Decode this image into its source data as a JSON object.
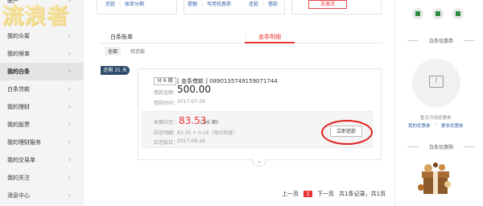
{
  "watermark": "流浪者",
  "sidebar": {
    "items": [
      {
        "label": "我的众筹"
      },
      {
        "label": "我的保单"
      },
      {
        "label": "我的白条"
      },
      {
        "label": "白条贷款"
      },
      {
        "label": "我的理财"
      },
      {
        "label": "我的股票"
      },
      {
        "label": "我的理财服务"
      },
      {
        "label": "我的交易单"
      },
      {
        "label": "我的关注"
      },
      {
        "label": "消息中心"
      }
    ],
    "partial_top": "账户",
    "active_index": 2
  },
  "top": {
    "links1": [
      "还款",
      "账单分期"
    ],
    "links2": [
      "提额",
      "可用优惠券"
    ],
    "links3": [
      "还款",
      "借款"
    ],
    "red_button": "去激活"
  },
  "tabs": {
    "items": [
      {
        "label": "白条账单"
      },
      {
        "label": "金条明细"
      }
    ],
    "active": 1
  },
  "filters": [
    {
      "label": "全部"
    },
    {
      "label": "待还款"
    }
  ],
  "record": {
    "remain_badge": "还剩 31 天",
    "term": "分 6 期",
    "title": "[ 金条借款 ] 0890135749159071744",
    "amount_label": "借款金额：",
    "amount": "500.00",
    "time_label": "借款时间：",
    "time": "2017-07-26",
    "due_label": "本期应还：",
    "due_amount": "83.53",
    "due_sub": "(1/6 期)",
    "detail_label": "应还明细：",
    "detail": "83.35 + 0.18（每日利息）",
    "due_date_label": "应还款日：",
    "due_date": "2017-08-26",
    "repay_button": "立即还款"
  },
  "pager": {
    "prev": "上一页",
    "current": "1",
    "next": "下一页",
    "summary": "共1条记录，共1页"
  },
  "right": {
    "coupon_title": "白条优惠券",
    "coupon_empty": "暂无可用优惠券",
    "coupon_link1": "我的优惠券",
    "coupon_link2": "更多优惠券",
    "shop_title": "白条优惠购"
  },
  "colors": {
    "accent": "#e33333",
    "link": "#2f5fa8",
    "badge": "#2c4a6a"
  }
}
